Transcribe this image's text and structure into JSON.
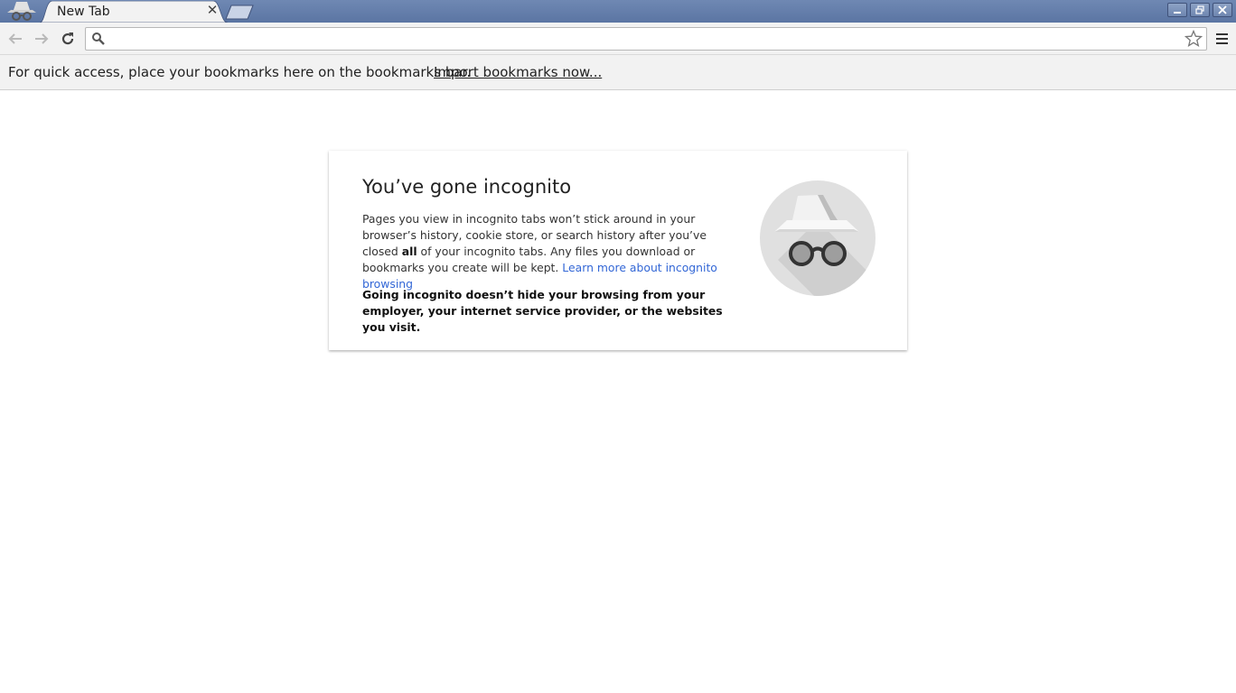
{
  "window": {
    "tab_title": "New Tab",
    "tab_close_glyph": "✕",
    "controls": [
      "minimize",
      "restore",
      "close"
    ],
    "incognito_icon": "incognito-icon"
  },
  "toolbar": {
    "back_icon": "back-arrow-icon",
    "forward_icon": "forward-arrow-icon",
    "reload_icon": "reload-icon",
    "omnibox_value": "",
    "omnibox_icon": "search-icon",
    "bookmark_star_icon": "star-icon",
    "menu_icon": "hamburger-menu-icon"
  },
  "bookmarks_bar": {
    "message": "For quick access, place your bookmarks here on the bookmarks bar.",
    "import_link": "Import bookmarks now..."
  },
  "card": {
    "heading": "You’ve gone incognito",
    "body_part1": "Pages you view in incognito tabs won’t stick around in your browser’s history, cookie store, or search history after you’ve closed ",
    "body_bold": "all",
    "body_part2": " of your incognito tabs. Any files you download or bookmarks you create will be kept. ",
    "learn_more": "Learn more about incognito browsing",
    "warning": "Going incognito doesn’t hide your browsing from your employer, your internet service provider, or the websites you visit.",
    "illustration": "incognito-spy-icon",
    "link_color": "#3367d6"
  }
}
